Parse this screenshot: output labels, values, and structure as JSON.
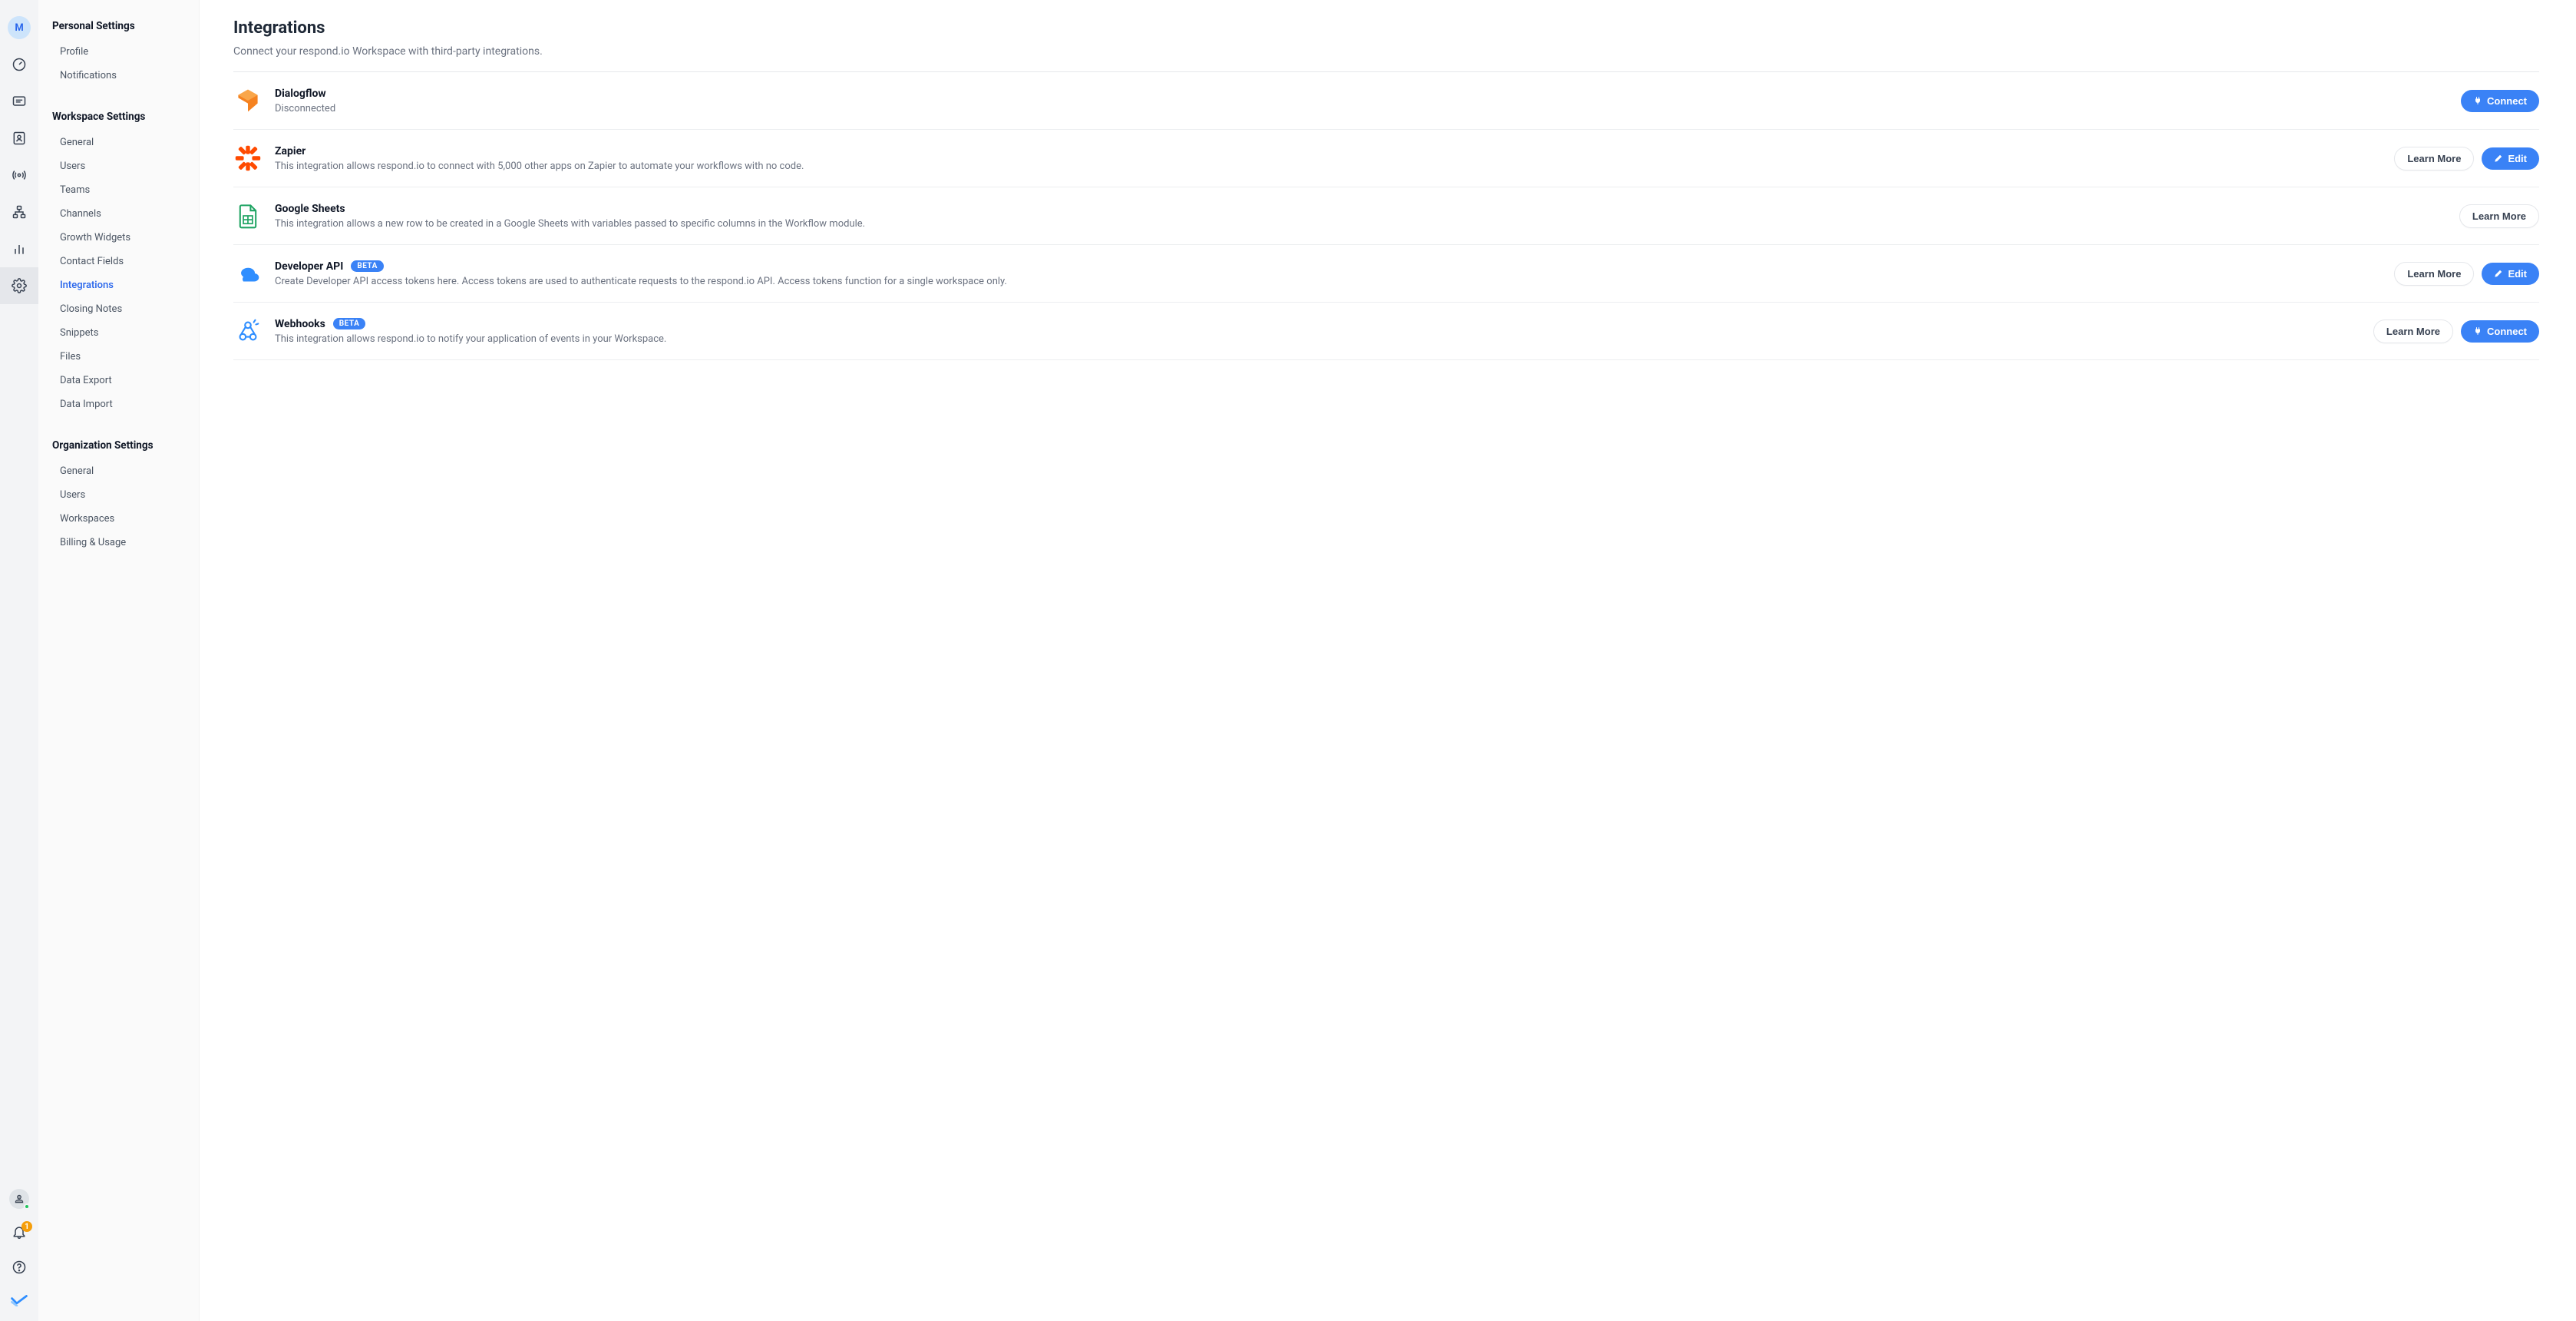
{
  "rail": {
    "avatarLetter": "M",
    "notificationCount": "1"
  },
  "sidebar": {
    "groups": [
      {
        "heading": "Personal Settings",
        "items": [
          {
            "label": "Profile",
            "active": false
          },
          {
            "label": "Notifications",
            "active": false
          }
        ]
      },
      {
        "heading": "Workspace Settings",
        "items": [
          {
            "label": "General",
            "active": false
          },
          {
            "label": "Users",
            "active": false
          },
          {
            "label": "Teams",
            "active": false
          },
          {
            "label": "Channels",
            "active": false
          },
          {
            "label": "Growth Widgets",
            "active": false
          },
          {
            "label": "Contact Fields",
            "active": false
          },
          {
            "label": "Integrations",
            "active": true
          },
          {
            "label": "Closing Notes",
            "active": false
          },
          {
            "label": "Snippets",
            "active": false
          },
          {
            "label": "Files",
            "active": false
          },
          {
            "label": "Data Export",
            "active": false
          },
          {
            "label": "Data Import",
            "active": false
          }
        ]
      },
      {
        "heading": "Organization Settings",
        "items": [
          {
            "label": "General",
            "active": false
          },
          {
            "label": "Users",
            "active": false
          },
          {
            "label": "Workspaces",
            "active": false
          },
          {
            "label": "Billing & Usage",
            "active": false
          }
        ]
      }
    ]
  },
  "page": {
    "title": "Integrations",
    "subtitle": "Connect your respond.io Workspace with third-party integrations."
  },
  "buttons": {
    "connect": "Connect",
    "learnMore": "Learn More",
    "edit": "Edit"
  },
  "badges": {
    "beta": "BETA"
  },
  "integrations": [
    {
      "key": "dialogflow",
      "title": "Dialogflow",
      "subtitle": "Disconnected",
      "actions": [
        "connect"
      ]
    },
    {
      "key": "zapier",
      "title": "Zapier",
      "subtitle": "This integration allows respond.io to connect with 5,000 other apps on Zapier to automate your workflows with no code.",
      "actions": [
        "learnMore",
        "edit"
      ]
    },
    {
      "key": "googlesheets",
      "title": "Google Sheets",
      "subtitle": "This integration allows a new row to be created in a Google Sheets with variables passed to specific columns in the Workflow module.",
      "actions": [
        "learnMore"
      ]
    },
    {
      "key": "devapi",
      "title": "Developer API",
      "badge": "beta",
      "subtitle": "Create Developer API access tokens here. Access tokens are used to authenticate requests to the respond.io API. Access tokens function for a single workspace only.",
      "actions": [
        "learnMore",
        "edit"
      ]
    },
    {
      "key": "webhooks",
      "title": "Webhooks",
      "badge": "beta",
      "subtitle": "This integration allows respond.io to notify your application of events in your Workspace.",
      "actions": [
        "learnMore",
        "connect"
      ]
    }
  ]
}
